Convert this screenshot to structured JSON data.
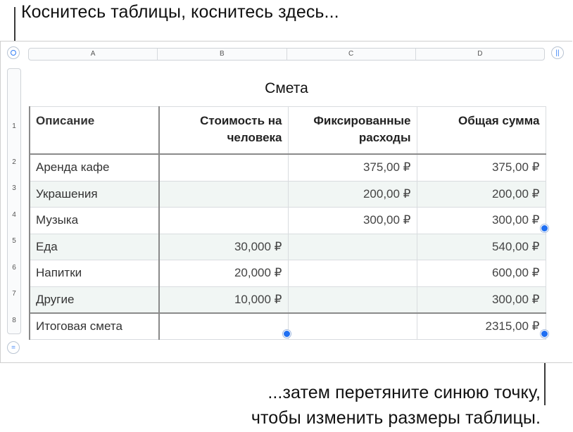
{
  "callouts": {
    "top": "Коснитесь таблицы, коснитесь здесь...",
    "bottom_line1": "...затем перетяните синюю точку,",
    "bottom_line2": "чтобы изменить размеры таблицы."
  },
  "colors": {
    "accent": "#1f6ff2",
    "alt_row": "#f1f6f4"
  },
  "column_letters": [
    "A",
    "B",
    "C",
    "D"
  ],
  "row_numbers": [
    "1",
    "2",
    "3",
    "4",
    "5",
    "6",
    "7",
    "8"
  ],
  "table": {
    "title": "Смета",
    "headers": [
      "Описание",
      "Стоимость на человека",
      "Фиксированные расходы",
      "Общая сумма"
    ],
    "rows": [
      [
        "Аренда кафе",
        "",
        "375,00 ₽",
        "375,00 ₽"
      ],
      [
        "Украшения",
        "",
        "200,00 ₽",
        "200,00 ₽"
      ],
      [
        "Музыка",
        "",
        "300,00 ₽",
        "300,00 ₽"
      ],
      [
        "Еда",
        "30,000 ₽",
        "",
        "540,00 ₽"
      ],
      [
        "Напитки",
        "20,000 ₽",
        "",
        "600,00 ₽"
      ],
      [
        "Другие",
        "10,000 ₽",
        "",
        "300,00 ₽"
      ]
    ],
    "footer": [
      "Итоговая смета",
      "",
      "",
      "2315,00 ₽"
    ]
  },
  "buttons": {
    "add_column_glyph": "||",
    "add_row_glyph": "="
  }
}
